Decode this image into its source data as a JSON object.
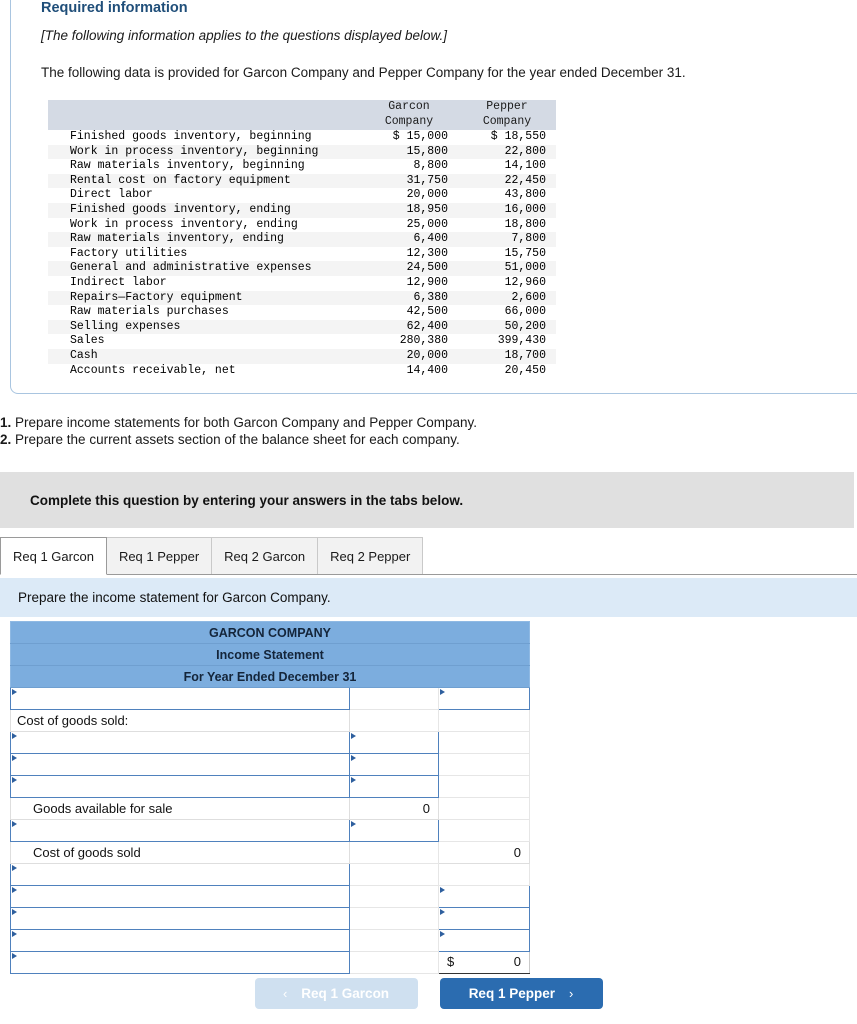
{
  "required_info": {
    "title": "Required information",
    "applies_note": "[The following information applies to the questions displayed below.]",
    "intro": "The following data is provided for Garcon Company and Pepper Company for the year ended December 31."
  },
  "data_table": {
    "col_blank": "",
    "headers": [
      {
        "line1": "Garcon",
        "line2": "Company"
      },
      {
        "line1": "Pepper",
        "line2": "Company"
      }
    ],
    "rows": [
      {
        "label": "Finished goods inventory, beginning",
        "garcon": "$ 15,000",
        "pepper": "$ 18,550"
      },
      {
        "label": "Work in process inventory, beginning",
        "garcon": "15,800",
        "pepper": "22,800"
      },
      {
        "label": "Raw materials inventory, beginning",
        "garcon": "8,800",
        "pepper": "14,100"
      },
      {
        "label": "Rental cost on factory equipment",
        "garcon": "31,750",
        "pepper": "22,450"
      },
      {
        "label": "Direct labor",
        "garcon": "20,000",
        "pepper": "43,800"
      },
      {
        "label": "Finished goods inventory, ending",
        "garcon": "18,950",
        "pepper": "16,000"
      },
      {
        "label": "Work in process inventory, ending",
        "garcon": "25,000",
        "pepper": "18,800"
      },
      {
        "label": "Raw materials inventory, ending",
        "garcon": "6,400",
        "pepper": "7,800"
      },
      {
        "label": "Factory utilities",
        "garcon": "12,300",
        "pepper": "15,750"
      },
      {
        "label": "General and administrative expenses",
        "garcon": "24,500",
        "pepper": "51,000"
      },
      {
        "label": "Indirect labor",
        "garcon": "12,900",
        "pepper": "12,960"
      },
      {
        "label": "Repairs—Factory equipment",
        "garcon": "6,380",
        "pepper": "2,600"
      },
      {
        "label": "Raw materials purchases",
        "garcon": "42,500",
        "pepper": "66,000"
      },
      {
        "label": "Selling expenses",
        "garcon": "62,400",
        "pepper": "50,200"
      },
      {
        "label": "Sales",
        "garcon": "280,380",
        "pepper": "399,430"
      },
      {
        "label": "Cash",
        "garcon": "20,000",
        "pepper": "18,700"
      },
      {
        "label": "Accounts receivable, net",
        "garcon": "14,400",
        "pepper": "20,450"
      }
    ]
  },
  "requirements": [
    {
      "num": "1.",
      "text": " Prepare income statements for both Garcon Company and Pepper Company."
    },
    {
      "num": "2.",
      "text": " Prepare the current assets section of the balance sheet for each company."
    }
  ],
  "gray_banner": {
    "text": "Complete this question by entering your answers in the tabs below."
  },
  "tabs": [
    {
      "label": "Req 1 Garcon",
      "active": true
    },
    {
      "label": "Req 1 Pepper",
      "active": false
    },
    {
      "label": "Req 2 Garcon",
      "active": false
    },
    {
      "label": "Req 2 Pepper",
      "active": false
    }
  ],
  "blue_banner": {
    "text": "Prepare the income statement for Garcon Company."
  },
  "form": {
    "header_lines": [
      "GARCON COMPANY",
      "Income Statement",
      "For Year Ended December 31"
    ],
    "labels": {
      "cost_of_goods_sold_header": "Cost of goods sold:",
      "goods_available_for_sale": "Goods available for sale",
      "cost_of_goods_sold": "Cost of goods sold"
    },
    "values": {
      "goods_available_for_sale": "0",
      "cost_of_goods_sold": "0",
      "net_income_symbol": "$",
      "net_income": "0"
    }
  },
  "nav": {
    "prev_label": "Req 1 Garcon",
    "prev_chevron": "‹",
    "next_label": "Req 1 Pepper",
    "next_chevron": "›"
  },
  "colors": {
    "header_blue": "#7cadde",
    "banner_blue": "#dceaf7",
    "banner_gray": "#e0e0e0",
    "title_blue": "#1f4e79",
    "input_border_blue": "#4f81bd",
    "btn_active": "#2b6cb0",
    "btn_disabled": "#cfe0f0"
  }
}
